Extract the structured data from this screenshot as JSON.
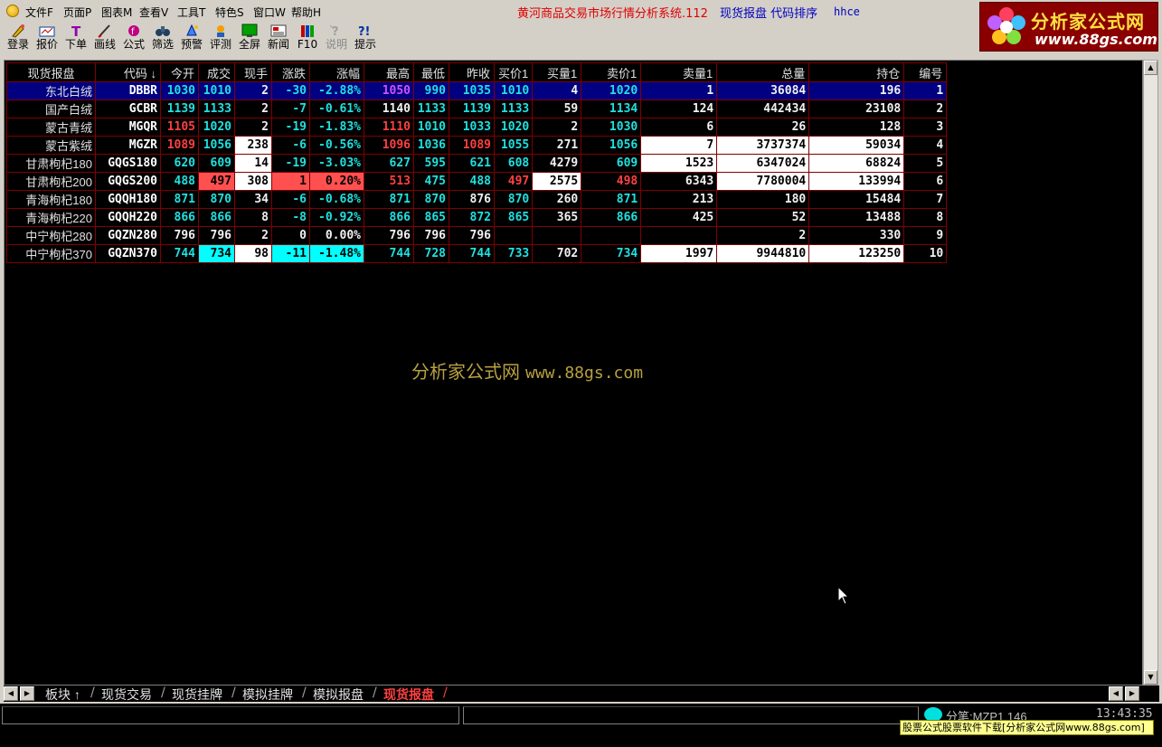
{
  "menubar": {
    "items": [
      "文件F",
      "页面P",
      "图表M",
      "查看V",
      "工具T",
      "特色S",
      "窗口W",
      "帮助H"
    ],
    "app_title": "黄河商品交易市场行情分析系统.112",
    "title_sub": "现货报盘  代码排序",
    "user": "hhce"
  },
  "toolbar": {
    "buttons": [
      {
        "label": "登录",
        "icon": "login-icon"
      },
      {
        "label": "报价",
        "icon": "quote-icon"
      },
      {
        "label": "下单",
        "icon": "order-icon"
      },
      {
        "label": "画线",
        "icon": "draw-icon"
      },
      {
        "label": "公式",
        "icon": "formula-icon"
      },
      {
        "label": "筛选",
        "icon": "filter-icon"
      },
      {
        "label": "预警",
        "icon": "alert-icon"
      },
      {
        "label": "评测",
        "icon": "evaluate-icon"
      },
      {
        "label": "全屏",
        "icon": "fullscreen-icon"
      },
      {
        "label": "新闻",
        "icon": "news-icon"
      },
      {
        "label": "F10",
        "icon": "f10-icon"
      },
      {
        "label": "说明",
        "icon": "help-icon"
      },
      {
        "label": "提示",
        "icon": "tips-icon"
      }
    ]
  },
  "logo": {
    "cn": "分析家公式网",
    "url": "www.88gs.com"
  },
  "table": {
    "columns": [
      "现货报盘",
      "代码  ↓",
      "今开",
      "成交",
      "现手",
      "涨跌",
      "涨幅",
      "最高",
      "最低",
      "昨收",
      "买价1",
      "买量1",
      "卖价1",
      "卖量1",
      "总量",
      "持仓",
      "编号"
    ],
    "rows": [
      {
        "name": "东北白绒",
        "code": "DBBR",
        "open": "1030",
        "last": "1010",
        "vol": "2",
        "chg": "-30",
        "pct": "-2.88%",
        "high": "1050",
        "low": "990",
        "prev": "1035",
        "bid": "1010",
        "bidvol": "4",
        "ask": "1020",
        "askvol": "1",
        "total": "36084",
        "oi": "196",
        "no": "1"
      },
      {
        "name": "国产白绒",
        "code": "GCBR",
        "open": "1139",
        "last": "1133",
        "vol": "2",
        "chg": "-7",
        "pct": "-0.61%",
        "high": "1140",
        "low": "1133",
        "prev": "1139",
        "bid": "1133",
        "bidvol": "59",
        "ask": "1134",
        "askvol": "124",
        "total": "442434",
        "oi": "23108",
        "no": "2"
      },
      {
        "name": "蒙古青绒",
        "code": "MGQR",
        "open": "1105",
        "last": "1020",
        "vol": "2",
        "chg": "-19",
        "pct": "-1.83%",
        "high": "1110",
        "low": "1010",
        "prev": "1033",
        "bid": "1020",
        "bidvol": "2",
        "ask": "1030",
        "askvol": "6",
        "total": "26",
        "oi": "128",
        "no": "3"
      },
      {
        "name": "蒙古紫绒",
        "code": "MGZR",
        "open": "1089",
        "last": "1056",
        "vol": "238",
        "chg": "-6",
        "pct": "-0.56%",
        "high": "1096",
        "low": "1036",
        "prev": "1089",
        "bid": "1055",
        "bidvol": "271",
        "ask": "1056",
        "askvol": "7",
        "total": "3737374",
        "oi": "59034",
        "no": "4"
      },
      {
        "name": "甘肃枸杞180",
        "code": "GQGS180",
        "open": "620",
        "last": "609",
        "vol": "14",
        "chg": "-19",
        "pct": "-3.03%",
        "high": "627",
        "low": "595",
        "prev": "621",
        "bid": "608",
        "bidvol": "4279",
        "ask": "609",
        "askvol": "1523",
        "total": "6347024",
        "oi": "68824",
        "no": "5"
      },
      {
        "name": "甘肃枸杞200",
        "code": "GQGS200",
        "open": "488",
        "last": "497",
        "vol": "308",
        "chg": "1",
        "pct": "0.20%",
        "high": "513",
        "low": "475",
        "prev": "488",
        "bid": "497",
        "bidvol": "2575",
        "ask": "498",
        "askvol": "6343",
        "total": "7780004",
        "oi": "133994",
        "no": "6"
      },
      {
        "name": "青海枸杞180",
        "code": "GQQH180",
        "open": "871",
        "last": "870",
        "vol": "34",
        "chg": "-6",
        "pct": "-0.68%",
        "high": "871",
        "low": "870",
        "prev": "876",
        "bid": "870",
        "bidvol": "260",
        "ask": "871",
        "askvol": "213",
        "total": "180",
        "oi": "15484",
        "no": "7"
      },
      {
        "name": "青海枸杞220",
        "code": "GQQH220",
        "open": "866",
        "last": "866",
        "vol": "8",
        "chg": "-8",
        "pct": "-0.92%",
        "high": "866",
        "low": "865",
        "prev": "872",
        "bid": "865",
        "bidvol": "365",
        "ask": "866",
        "askvol": "425",
        "total": "52",
        "oi": "13488",
        "no": "8"
      },
      {
        "name": "中宁枸杞280",
        "code": "GQZN280",
        "open": "796",
        "last": "796",
        "vol": "2",
        "chg": "0",
        "pct": "0.00%",
        "high": "796",
        "low": "796",
        "prev": "796",
        "bid": "",
        "bidvol": "",
        "ask": "",
        "askvol": "",
        "total": "2",
        "oi": "330",
        "no": "9"
      },
      {
        "name": "中宁枸杞370",
        "code": "GQZN370",
        "open": "744",
        "last": "734",
        "vol": "98",
        "chg": "-11",
        "pct": "-1.48%",
        "high": "744",
        "low": "728",
        "prev": "744",
        "bid": "733",
        "bidvol": "702",
        "ask": "734",
        "askvol": "1997",
        "total": "9944810",
        "oi": "123250",
        "no": "10"
      }
    ]
  },
  "watermark": {
    "cn": "分析家公式网",
    "url": "www.88gs.com"
  },
  "tabs": [
    "板块 ↑",
    "现货交易",
    "现货挂牌",
    "模拟挂牌",
    "模拟报盘",
    "现货报盘"
  ],
  "status": {
    "text": "分笔:MZP1 146",
    "time": "13:43:35",
    "ad": "股票公式股票软件下载[分析家公式网www.88gs.com]"
  },
  "colors": {
    "up": "#ff4040",
    "down": "#20e0e0",
    "flat": "#f0f0f0",
    "selected_row": "#000080",
    "grid": "#800000"
  }
}
